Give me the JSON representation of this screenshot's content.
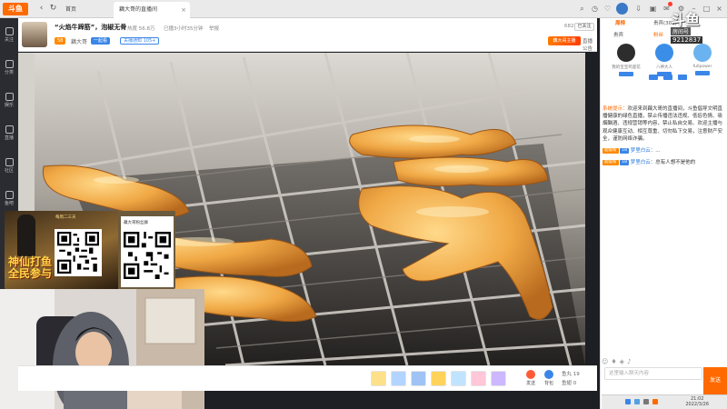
{
  "app": {
    "logo": "斗鱼"
  },
  "tabs": [
    {
      "label": "首页",
      "active": false
    },
    {
      "label": "藕大哥的直播间",
      "active": true,
      "close": "×"
    }
  ],
  "leftnav": [
    {
      "label": "关注",
      "icon": "heart-icon"
    },
    {
      "label": "分类",
      "icon": "grid-icon"
    },
    {
      "label": "娱乐",
      "icon": "game-icon"
    },
    {
      "label": "直播",
      "icon": "tv-icon"
    },
    {
      "label": "社区",
      "icon": "chat-icon"
    },
    {
      "label": "鱼吧",
      "icon": "fish-icon"
    },
    {
      "label": "推荐",
      "icon": "star-icon"
    }
  ],
  "room": {
    "title": "“火焰牛蹄筋”，泡椒无骨",
    "anchor_name": "藕大哥",
    "level": "58",
    "badge_level": "一起看",
    "badge_fans": "关播通知 105+",
    "stat_hot": "热度 56.8万",
    "stat_watch": "已播3小时35分钟",
    "stat_report": "举报",
    "room_id": "6826552",
    "follow": "已关注",
    "promo": "藕大哥主播",
    "link_share": "直播公告"
  },
  "promo_overlay": {
    "tag": "每周二三天",
    "text_line1": "神仙打鱼",
    "text_line2": "全民参与",
    "qr_caption": "藕大哥粉丝群"
  },
  "toolbar": {
    "gifts": [
      "rocket",
      "plane",
      "car",
      "stick",
      "cake",
      "candy",
      "gift"
    ],
    "btn_send": "发送",
    "btn_bag": "背包",
    "fish_balls": "鱼丸 19",
    "fish_fins": "鱼翅 0"
  },
  "rightpanel": {
    "tabs": [
      "周榜",
      "贵宾",
      "粉丝",
      "贵宾(301)"
    ],
    "ranking": [
      {
        "name": "我的宝宝鸡蛋花",
        "color": "#2d2d2d"
      },
      {
        "name": "八神大人",
        "color": "#3b8ee8"
      },
      {
        "name": "fullpower",
        "color": "#6bb3f0"
      }
    ],
    "logo_main": "斗鱼",
    "logo_sub": "房间号",
    "room_number": "9212837",
    "chat": [
      {
        "type": "system",
        "tag": "系统提示：",
        "text": "欢迎来到藕大哥的直播间，斗鱼倡导文明直播健康的绿色直播，禁止传播违法违规、低俗色情、吸烟酗酒、违规营销等内容，禁止私自交易、欢迎主播与观众健康互动、相互尊重、切勿私下交易，注意财产安全，谨防网络诈骗。"
      },
      {
        "type": "user",
        "badge": "超级粉",
        "badge2": "18",
        "nick": "梦里白云：",
        "text": "..."
      },
      {
        "type": "user",
        "badge": "超级粉",
        "badge2": "18",
        "nick": "梦里白云：",
        "text": "总有人想不是他的"
      }
    ],
    "input_placeholder": "这里输入聊天内容",
    "send": "发送"
  },
  "tray": {
    "time": "21:02",
    "date": "2022/3/26"
  },
  "colors": {
    "accent": "#ff6a00",
    "link": "#2f7bd9",
    "badge_blue": "#3a86e8"
  }
}
